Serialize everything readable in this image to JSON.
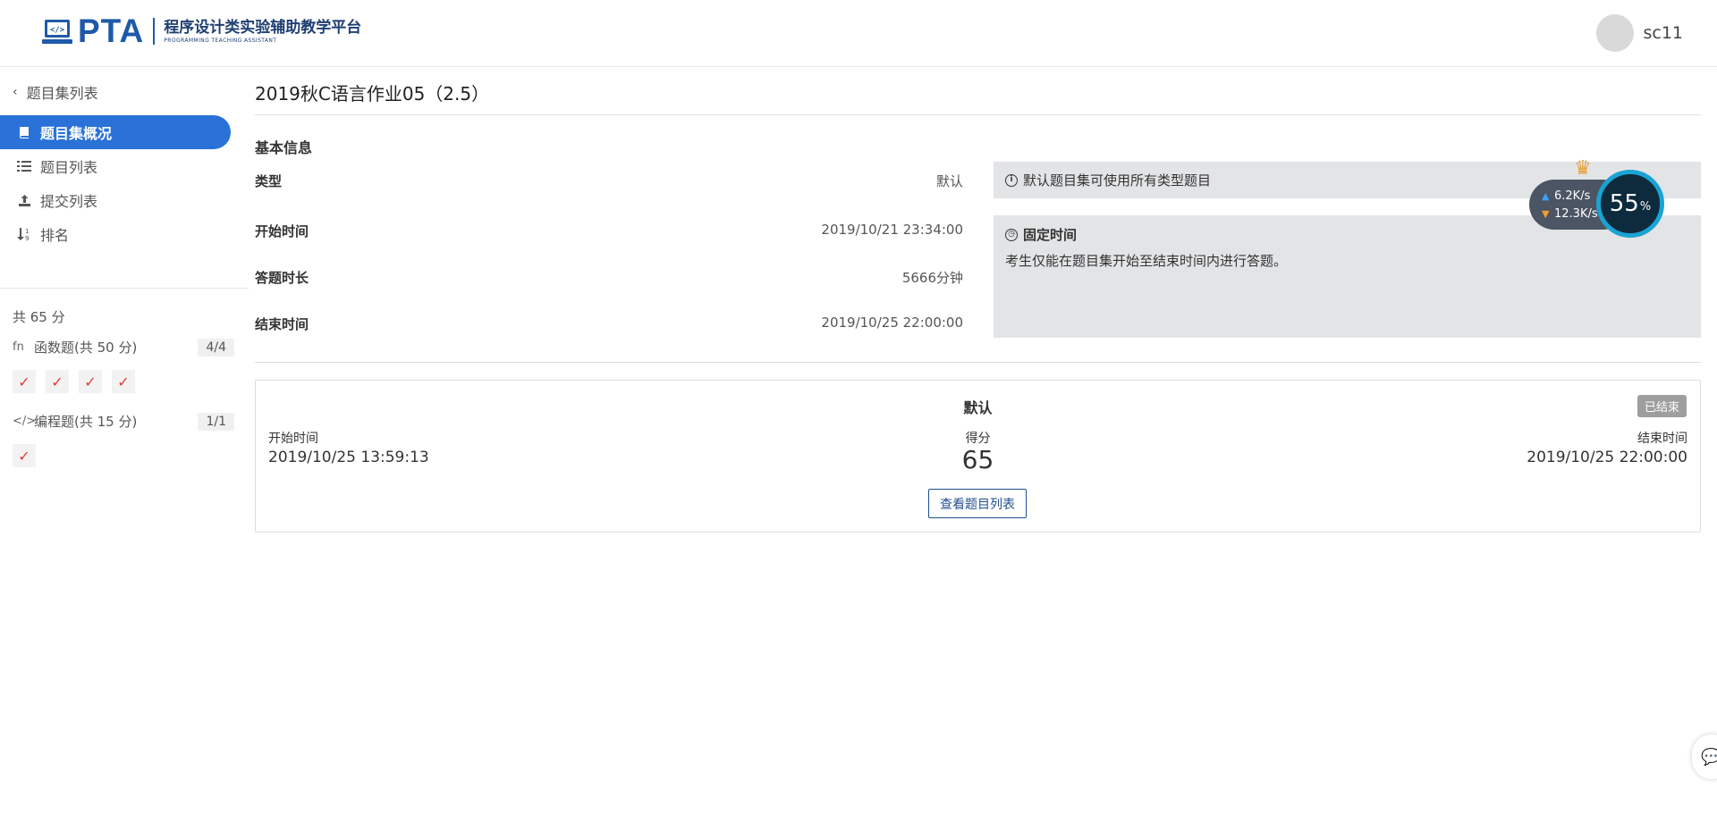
{
  "header": {
    "logo_pta": "PTA",
    "logo_cn": "程序设计类实验辅助教学平台",
    "logo_en": "PROGRAMMING TEACHING ASSISTANT",
    "username": "sc11"
  },
  "sidebar": {
    "back_label": "题目集列表",
    "items": [
      {
        "label": "题目集概况",
        "icon": "book-icon",
        "active": true
      },
      {
        "label": "题目列表",
        "icon": "list-icon",
        "active": false
      },
      {
        "label": "提交列表",
        "icon": "upload-icon",
        "active": false
      },
      {
        "label": "排名",
        "icon": "sort-icon",
        "active": false
      }
    ],
    "total_score": "共 65 分",
    "categories": [
      {
        "label": "函数题(共 50 分)",
        "icon_text": "fn",
        "count": "4/4",
        "checks": [
          "✓",
          "✓",
          "✓",
          "✓"
        ]
      },
      {
        "label": "编程题(共 15 分)",
        "icon_text": "</>",
        "count": "1/1",
        "checks": [
          "✓"
        ]
      }
    ]
  },
  "main": {
    "title": "2019秋C语言作业05（2.5）",
    "section_title": "基本信息",
    "info": [
      {
        "label": "类型",
        "value": "默认"
      },
      {
        "label": "开始时间",
        "value": "2019/10/21 23:34:00"
      },
      {
        "label": "答题时长",
        "value": "5666分钟"
      },
      {
        "label": "结束时间",
        "value": "2019/10/25 22:00:00"
      }
    ],
    "note_type": "默认题目集可使用所有类型题目",
    "note_fixed_title": "固定时间",
    "note_fixed_text": "考生仅能在题目集开始至结束时间内进行答题。"
  },
  "card": {
    "title": "默认",
    "status_badge": "已结束",
    "start_label": "开始时间",
    "start_value": "2019/10/25 13:59:13",
    "score_label": "得分",
    "score_value": "65",
    "end_label": "结束时间",
    "end_value": "2019/10/25 22:00:00",
    "view_button": "查看题目列表"
  },
  "speed_widget": {
    "upload": "6.2K/s",
    "download": "12.3K/s",
    "percent": "55",
    "percent_unit": "%"
  },
  "colors": {
    "accent": "#2a71d8",
    "brand": "#1f5aa8",
    "check": "#e53935",
    "note_bg": "#e3e4e6",
    "badge_bg": "#9e9e9e"
  }
}
